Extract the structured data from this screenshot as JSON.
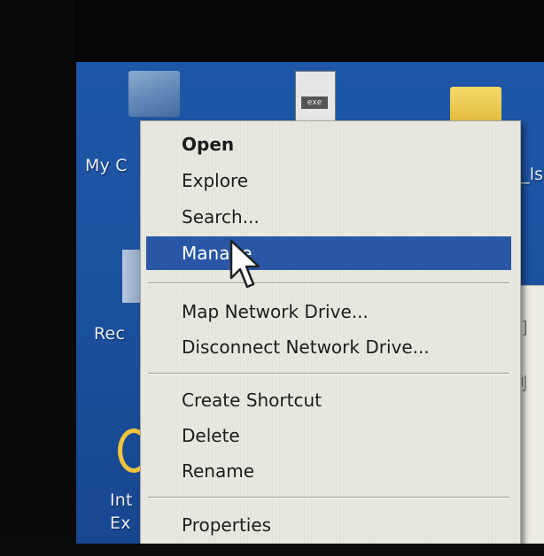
{
  "desktop": {
    "labels": {
      "my_computer": "My C",
      "recycle": "Rec",
      "internet_1": "Int",
      "internet_2": "Ex",
      "right_fragment": "_ls"
    },
    "doc_icon_tag": "exe",
    "behind_window_chars": [
      "3]",
      "制"
    ]
  },
  "context_menu": {
    "groups": [
      [
        {
          "label": "Open",
          "bold": true
        },
        {
          "label": "Explore"
        },
        {
          "label": "Search..."
        },
        {
          "label": "Manage",
          "highlighted": true
        }
      ],
      [
        {
          "label": "Map Network Drive..."
        },
        {
          "label": "Disconnect Network Drive..."
        }
      ],
      [
        {
          "label": "Create Shortcut"
        },
        {
          "label": "Delete"
        },
        {
          "label": "Rename"
        }
      ],
      [
        {
          "label": "Properties"
        }
      ]
    ]
  },
  "colors": {
    "desktop_blue": "#1f57a8",
    "menu_bg": "#e8e8e0",
    "highlight": "#2a57a5"
  },
  "icons": [
    "my-computer-icon",
    "document-icon",
    "folder-icon",
    "recycle-bin-icon",
    "internet-explorer-icon",
    "mouse-pointer-icon"
  ]
}
